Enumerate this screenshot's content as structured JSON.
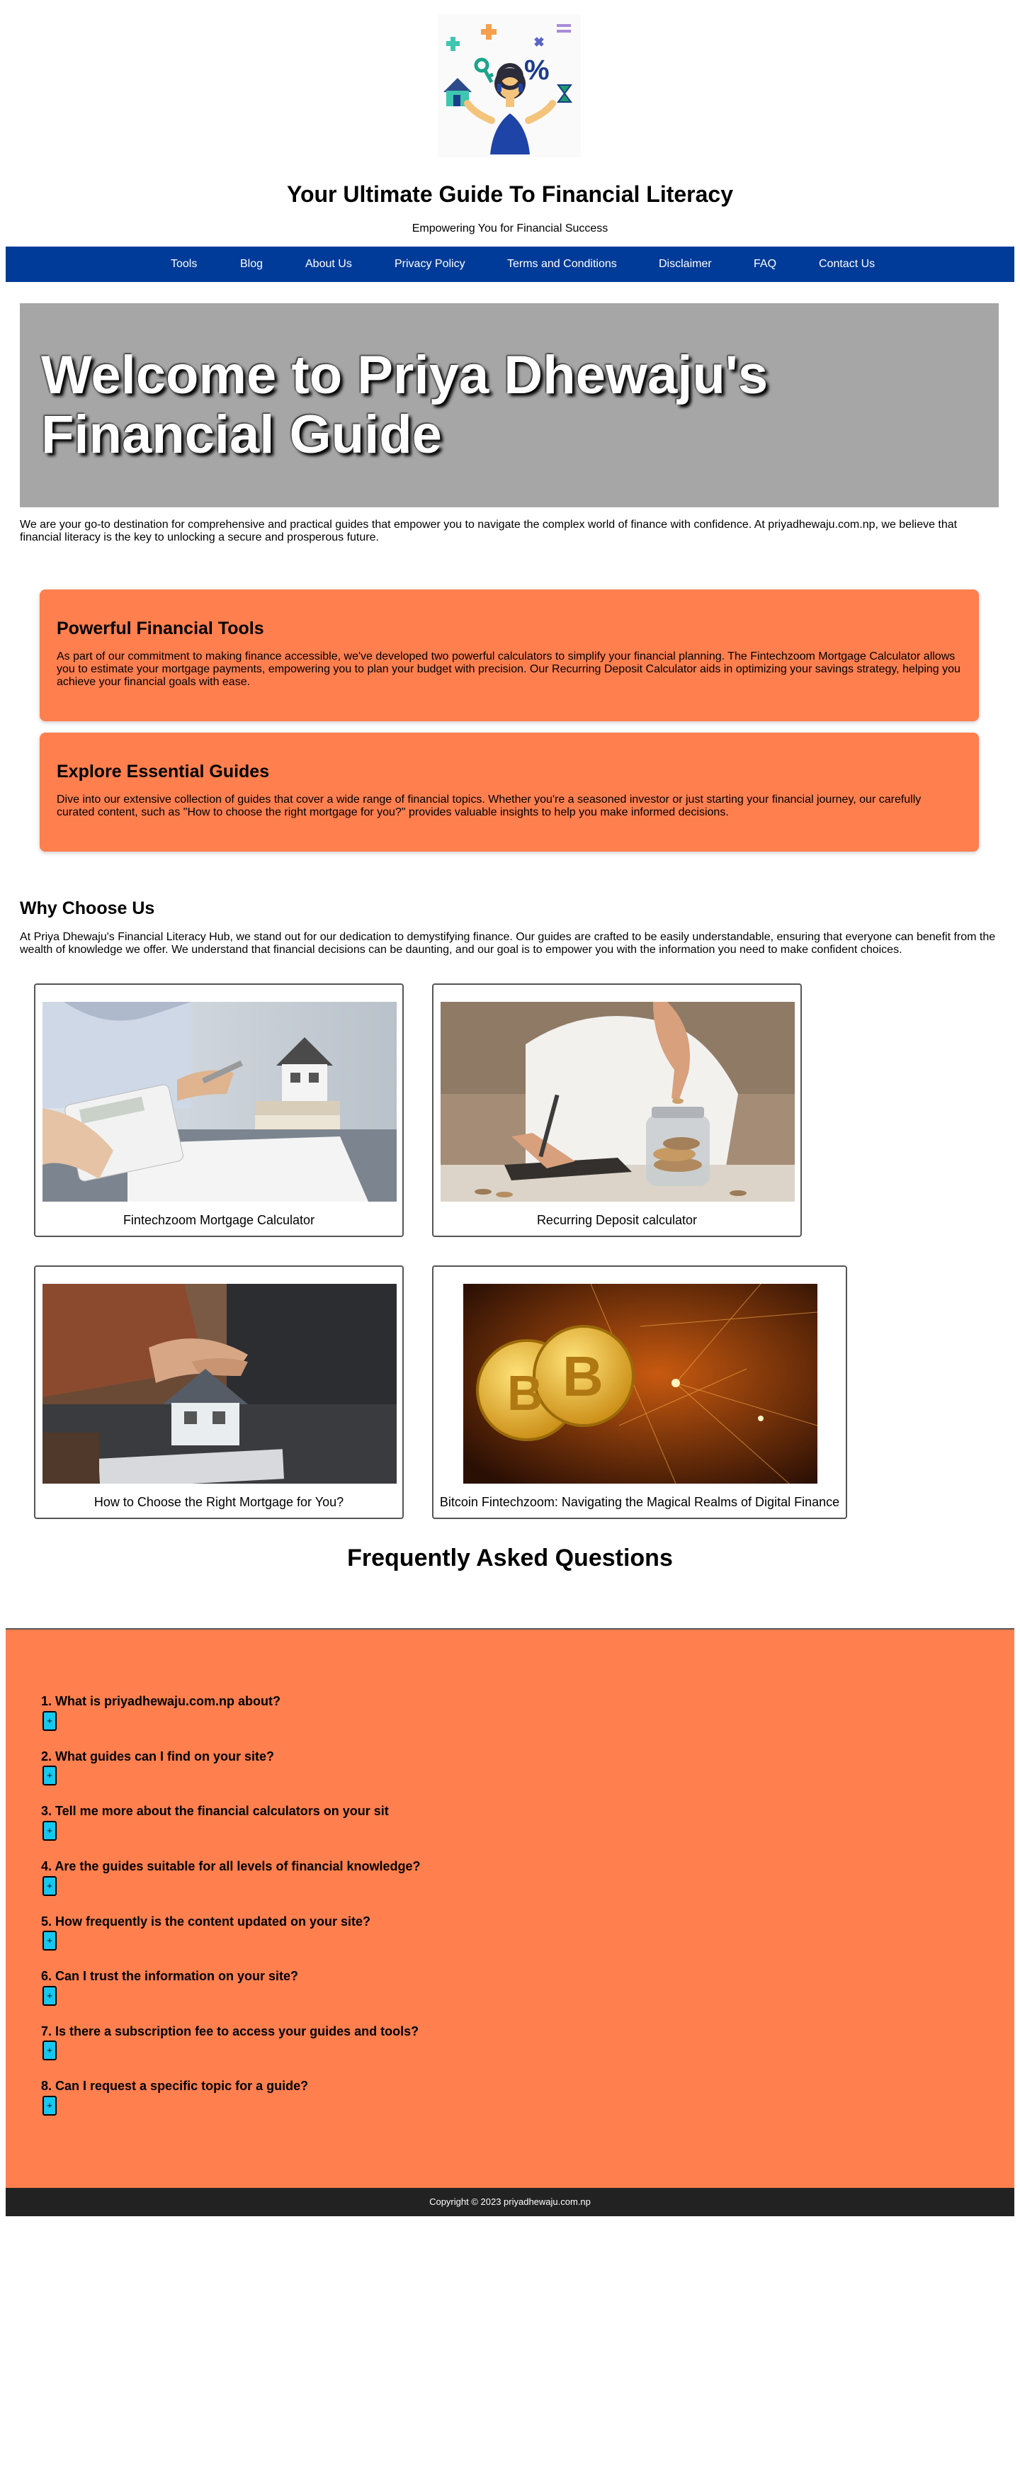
{
  "header": {
    "title": "Your Ultimate Guide To Financial Literacy",
    "tagline": "Empowering You for Financial Success",
    "logo_icon": "finance-woman-logo-icon"
  },
  "nav": {
    "items": [
      {
        "label": "Tools"
      },
      {
        "label": "Blog"
      },
      {
        "label": "About Us"
      },
      {
        "label": "Privacy Policy"
      },
      {
        "label": "Terms and Conditions"
      },
      {
        "label": "Disclaimer"
      },
      {
        "label": "FAQ"
      },
      {
        "label": "Contact Us"
      }
    ],
    "color": "#003b99"
  },
  "hero": {
    "title": "Welcome to Priya Dhewaju's Financial Guide"
  },
  "intro": "We are your go-to destination for comprehensive and practical guides that empower you to navigate the complex world of finance with confidence. At priyadhewaju.com.np, we believe that financial literacy is the key to unlocking a secure and prosperous future.",
  "features": [
    {
      "title": "Powerful Financial Tools",
      "text": "As part of our commitment to making finance accessible, we've developed two powerful calculators to simplify your financial planning. The Fintechzoom Mortgage Calculator allows you to estimate your mortgage payments, empowering you to plan your budget with precision. Our Recurring Deposit Calculator aids in optimizing your savings strategy, helping you achieve your financial goals with ease."
    },
    {
      "title": "Explore Essential Guides",
      "text": "Dive into our extensive collection of guides that cover a wide range of financial topics. Whether you're a seasoned investor or just starting your financial journey, our carefully curated content, such as \"How to choose the right mortgage for you?\" provides valuable insights to help you make informed decisions."
    }
  ],
  "why": {
    "title": "Why Choose Us",
    "text": "At Priya Dhewaju's Financial Literacy Hub, we stand out for our dedication to demystifying finance. Our guides are crafted to be easily understandable, ensuring that everyone can benefit from the wealth of knowledge we offer. We understand that financial decisions can be daunting, and our goal is to empower you with the information you need to make confident choices."
  },
  "cards": [
    {
      "caption": "Fintechzoom Mortgage Calculator",
      "image": "calculator-house-photo"
    },
    {
      "caption": "Recurring Deposit calculator",
      "image": "coin-jar-photo"
    },
    {
      "caption": "How to Choose the Right Mortgage for You?",
      "image": "handshake-house-photo"
    },
    {
      "caption": "Bitcoin Fintechzoom: Navigating the Magical Realms of Digital Finance",
      "image": "bitcoin-photo"
    }
  ],
  "faq": {
    "title": "Frequently Asked Questions",
    "toggle_label": "+",
    "questions": [
      "1. What is priyadhewaju.com.np about?",
      "2. What guides can I find on your site?",
      "3. Tell me more about the financial calculators on your sit",
      "4. Are the guides suitable for all levels of financial knowledge?",
      "5. How frequently is the content updated on your site?",
      "6. Can I trust the information on your site?",
      "7. Is there a subscription fee to access your guides and tools?",
      "8. Can I request a specific topic for a guide?"
    ],
    "background": "#ff7f4f",
    "toggle_color": "#16c7f0"
  },
  "footer": {
    "copyright": "Copyright © 2023 priyadhewaju.com.np"
  }
}
